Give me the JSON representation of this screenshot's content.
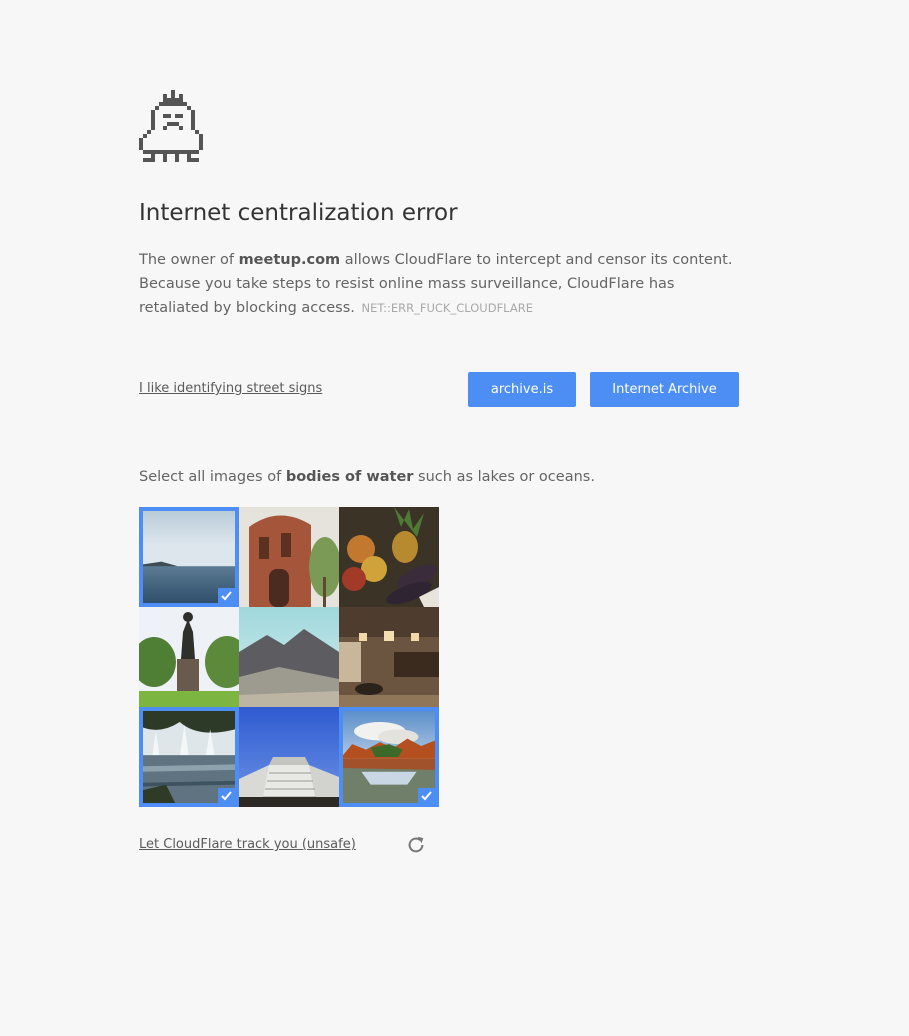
{
  "error": {
    "title": "Internet centralization error",
    "owner_prefix": "The owner of",
    "domain": "meetup.com",
    "description_rest": "allows CloudFlare to intercept and censor its content. Because you take steps to resist online mass surveillance, CloudFlare has retaliated by blocking access.",
    "code": "NET::ERR_FUCK_CLOUDFLARE"
  },
  "actions": {
    "street_signs_link": "I like identifying street signs",
    "archive_is_label": "archive.is",
    "internet_archive_label": "Internet Archive"
  },
  "captcha": {
    "prompt_prefix": "Select all images of",
    "prompt_target": "bodies of water",
    "prompt_suffix": "such as lakes or oceans.",
    "tiles": [
      {
        "name": "tile-sea-horizon",
        "selected": true
      },
      {
        "name": "tile-brick-building",
        "selected": false
      },
      {
        "name": "tile-fruit-vegetables",
        "selected": false
      },
      {
        "name": "tile-statue-park",
        "selected": false
      },
      {
        "name": "tile-mountains",
        "selected": false
      },
      {
        "name": "tile-interior-room",
        "selected": false
      },
      {
        "name": "tile-fountain-lake",
        "selected": true
      },
      {
        "name": "tile-modern-stairs",
        "selected": false
      },
      {
        "name": "tile-autumn-lake",
        "selected": true
      }
    ],
    "track_link": "Let CloudFlare track you (unsafe)"
  },
  "colors": {
    "accent": "#4d8ef5",
    "background": "#f7f7f7",
    "title": "#333333",
    "text": "#646464"
  }
}
